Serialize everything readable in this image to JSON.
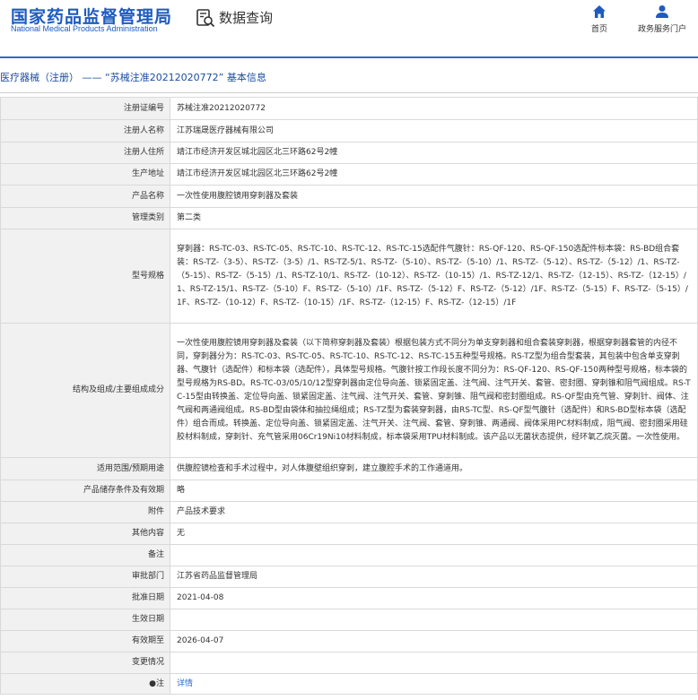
{
  "header": {
    "logo_cn": "国家药品监督管理局",
    "logo_en": "National Medical Products Administration",
    "search_title": "数据查询",
    "nav": [
      {
        "label": "首页",
        "icon": "home-icon"
      },
      {
        "label": "政务服务门户",
        "icon": "user-icon"
      }
    ]
  },
  "colors": {
    "brand": "#1d5bbf",
    "accent_line": "#2b6bd1",
    "title": "#1a4da0",
    "label_bg": "#f1f1f1",
    "border": "#d9d9d9"
  },
  "page_title": "医疗器械（注册） —— “苏械注准20212020772” 基本信息",
  "rows": [
    {
      "label": "注册证编号",
      "value": "苏械注准20212020772"
    },
    {
      "label": "注册人名称",
      "value": "江苏瑞晟医疗器械有限公司"
    },
    {
      "label": "注册人住所",
      "value": "靖江市经济开发区城北园区北三环路62号2幢"
    },
    {
      "label": "生产地址",
      "value": "靖江市经济开发区城北园区北三环路62号2幢"
    },
    {
      "label": "产品名称",
      "value": "一次性使用腹腔镜用穿刺器及套装"
    },
    {
      "label": "管理类别",
      "value": "第二类"
    },
    {
      "label": "型号规格",
      "value": "穿刺器：RS-TC-03、RS-TC-05、RS-TC-10、RS-TC-12、RS-TC-15选配件气腹针：RS-QF-120、RS-QF-150选配件标本袋：RS-BD组合套装：RS-TZ-（3-5）、RS-TZ-（3-5）/1、RS-TZ-5/1、RS-TZ-（5-10）、RS-TZ-（5-10）/1、RS-TZ-（5-12）、RS-TZ-（5-12）/1、RS-TZ-（5-15）、RS-TZ-（5-15）/1、RS-TZ-10/1、RS-TZ-（10-12）、RS-TZ-（10-15）/1、RS-TZ-12/1、RS-TZ-（12-15）、RS-TZ-（12-15）/1、RS-TZ-15/1、RS-TZ-（5-10）F、RS-TZ-（5-10）/1F、RS-TZ-（5-12）F、RS-TZ-（5-12）/1F、RS-TZ-（5-15）F、RS-TZ-（5-15）/1F、RS-TZ-（10-12）F、RS-TZ-（10-15）/1F、RS-TZ-（12-15）F、RS-TZ-（12-15）/1F"
    },
    {
      "label": "结构及组成/主要组成成分",
      "value": "一次性使用腹腔镜用穿刺器及套装（以下简称穿刺器及套装）根据包装方式不同分为单支穿刺器和组合套装穿刺器，根据穿刺器套管的内径不同，穿刺器分为：RS-TC-03、RS-TC-05、RS-TC-10、RS-TC-12、RS-TC-15五种型号规格。RS-TZ型为组合型套装，其包装中包含单支穿刺器、气腹针（选配件）和标本袋（选配件），具体型号规格。气腹针按工作段长度不同分为：RS-QF-120、RS-QF-150两种型号规格，标本袋的型号规格为RS-BD。RS-TC-03/05/10/12型穿刺器由定位导向盖、锁紧固定盖、注气阀、注气开关、套管、密封圈、穿刺锥和阻气阀组成。RS-TC-15型由转换盖、定位导向盖、锁紧固定盖、注气阀、注气开关、套管、穿刺锥、阻气阀和密封圈组成。RS-QF型由充气管、穿刺针、阀体、注气阀和两通阀组成。RS-BD型由袋体和抽拉绳组成；RS-TZ型为套装穿刺器，由RS-TC型、RS-QF型气腹针（选配件）和RS-BD型标本袋（选配件）组合而成。转换盖、定位导向盖、锁紧固定盖、注气开关、注气阀、套管、穿刺锥、两通阀、阀体采用PC材料制成，阻气阀、密封圈采用硅胶材料制成，穿刺针、充气管采用06Cr19Ni10材料制成，标本袋采用TPU材料制成。该产品以无菌状态提供，经环氧乙烷灭菌。一次性使用。"
    },
    {
      "label": "适用范围/预期用途",
      "value": "供腹腔镜检查和手术过程中，对人体腹壁组织穿刺，建立腹腔手术的工作通道用。"
    },
    {
      "label": "产品储存条件及有效期",
      "value": "略"
    },
    {
      "label": "附件",
      "value": "产品技术要求"
    },
    {
      "label": "其他内容",
      "value": "无"
    },
    {
      "label": "备注",
      "value": ""
    },
    {
      "label": "审批部门",
      "value": "江苏省药品监督管理局"
    },
    {
      "label": "批准日期",
      "value": "2021-04-08"
    },
    {
      "label": "生效日期",
      "value": ""
    },
    {
      "label": "有效期至",
      "value": "2026-04-07"
    },
    {
      "label": "变更情况",
      "value": ""
    },
    {
      "label": "●注",
      "value": "详情"
    }
  ]
}
